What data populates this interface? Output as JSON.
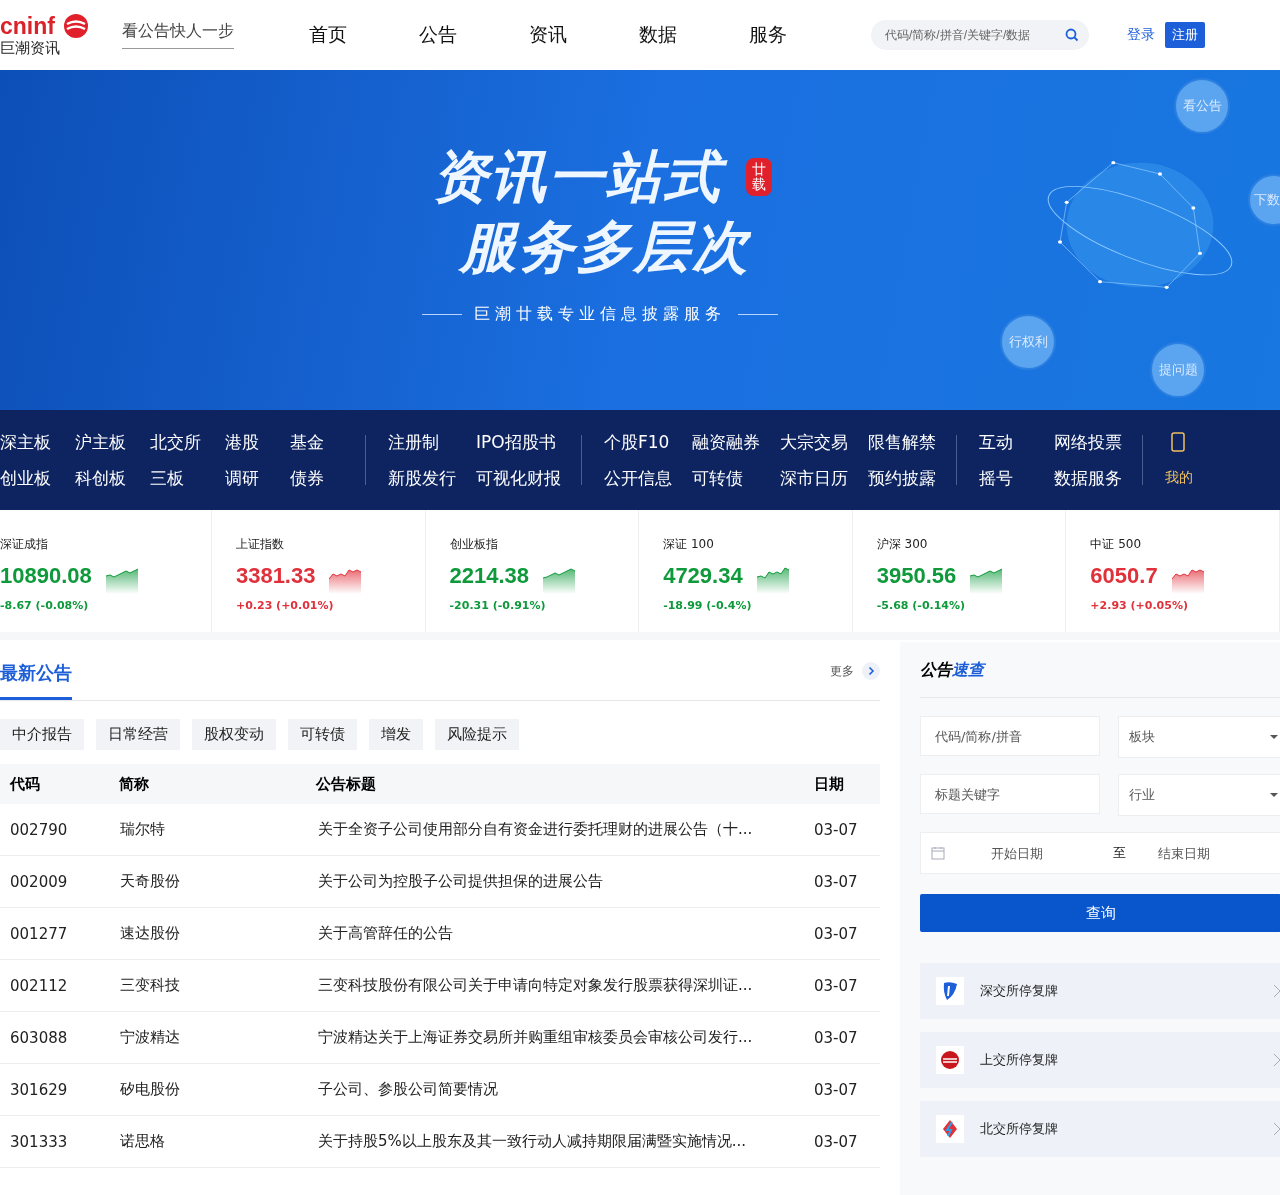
{
  "header": {
    "logo_mark": "cninf",
    "logo_name": "巨潮资讯",
    "slogan": "看公告快人一步",
    "nav": [
      {
        "label": "首页",
        "selected": false
      },
      {
        "label": "公告",
        "selected": false
      },
      {
        "label": "资讯",
        "selected": false
      },
      {
        "label": "数据",
        "selected": false
      },
      {
        "label": "服务",
        "selected": false
      }
    ],
    "search": {
      "placeholder": "代码/简称/拼音/关键字/数据"
    },
    "login": "登录",
    "register": "注册"
  },
  "banner": {
    "headline_1": "资讯一站式",
    "headline_2": "服务多层次",
    "badge": "廿载",
    "tagline": "巨潮廿载专业信息披露服务",
    "bubbles": [
      "看公告",
      "下数",
      "行权利",
      "提问题"
    ]
  },
  "quick_nav": [
    {
      "columns": [
        [
          "深主板",
          "创业板"
        ],
        [
          "沪主板",
          "科创板"
        ],
        [
          "北交所",
          "三板"
        ],
        [
          "港股",
          "调研"
        ],
        [
          "基金",
          "债券"
        ]
      ]
    },
    {
      "columns": [
        [
          "注册制",
          "新股发行"
        ],
        [
          "IPO招股书",
          "可视化财报"
        ]
      ]
    },
    {
      "columns": [
        [
          "个股F10",
          "公开信息"
        ],
        [
          "融资融券",
          "可转债"
        ],
        [
          "大宗交易",
          "深市日历"
        ],
        [
          "限售解禁",
          "预约披露"
        ]
      ]
    },
    {
      "columns": [
        [
          "互动",
          "摇号"
        ],
        [
          "网络投票",
          "数据服务"
        ]
      ]
    },
    {
      "columns": [
        [
          "我的"
        ]
      ]
    }
  ],
  "indices": [
    {
      "name": "深证成指",
      "value": "10890.08",
      "change": "-8.67 (-0.08%)",
      "color": "#0e9a3b"
    },
    {
      "name": "上证指数",
      "value": "3381.33",
      "change": "+0.23 (+0.01%)",
      "color": "#e0313b"
    },
    {
      "name": "创业板指",
      "value": "2214.38",
      "change": "-20.31 (-0.91%)",
      "color": "#0e9a3b"
    },
    {
      "name": "深证 100",
      "value": "4729.34",
      "change": "-18.99 (-0.4%)",
      "color": "#0e9a3b"
    },
    {
      "name": "沪深 300",
      "value": "3950.56",
      "change": "-5.68 (-0.14%)",
      "color": "#0e9a3b"
    },
    {
      "name": "中证 500",
      "value": "6050.7",
      "change": "+2.93 (+0.05%)",
      "color": "#e0313b"
    }
  ],
  "announcements": {
    "title": "最新公告",
    "more": "更多",
    "categories": [
      "中介报告",
      "日常经营",
      "股权变动",
      "可转债",
      "增发",
      "风险提示"
    ],
    "columns": [
      "代码",
      "简称",
      "公告标题",
      "日期"
    ],
    "rows": [
      [
        "002790",
        "瑞尔特",
        "关于全资子公司使用部分自有资金进行委托理财的进展公告（十...",
        "03-07"
      ],
      [
        "002009",
        "天奇股份",
        "关于公司为控股子公司提供担保的进展公告",
        "03-07"
      ],
      [
        "001277",
        "速达股份",
        "关于高管辞任的公告",
        "03-07"
      ],
      [
        "002112",
        "三变科技",
        "三变科技股份有限公司关于申请向特定对象发行股票获得深圳证...",
        "03-07"
      ],
      [
        "603088",
        "宁波精达",
        "宁波精达关于上海证券交易所并购重组审核委员会审核公司发行...",
        "03-07"
      ],
      [
        "301629",
        "矽电股份",
        "子公司、参股公司简要情况",
        "03-07"
      ],
      [
        "301333",
        "诺思格",
        "关于持股5%以上股东及其一致行动人减持期限届满暨实施情况...",
        "03-07"
      ]
    ]
  },
  "quick_search": {
    "title_plain": "公告",
    "title_accent": "速查",
    "code_field": {
      "placeholder": "代码/简称/拼音"
    },
    "board_select": {
      "placeholder": "板块"
    },
    "keyword_field": {
      "placeholder": "标题关键字"
    },
    "industry_select": {
      "placeholder": "行业"
    },
    "start_date": {
      "placeholder": "开始日期"
    },
    "range_sep": "至",
    "end_date": {
      "placeholder": "结束日期"
    },
    "query_button": "查询",
    "links": [
      {
        "label": "深交所停复牌",
        "kind": "szse"
      },
      {
        "label": "上交所停复牌",
        "kind": "sse"
      },
      {
        "label": "北交所停复牌",
        "kind": "bse"
      }
    ]
  }
}
